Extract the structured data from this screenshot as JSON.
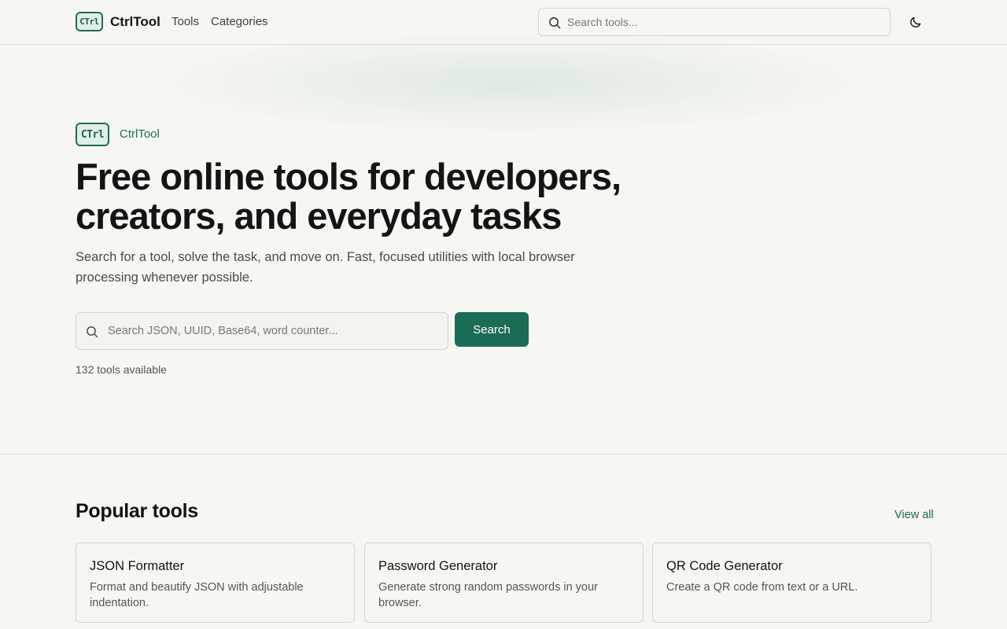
{
  "header": {
    "logo_text": "CTrl",
    "brand": "CtrlTool",
    "nav": [
      {
        "label": "Tools"
      },
      {
        "label": "Categories"
      }
    ],
    "search_placeholder": "Search tools...",
    "theme_icon": "moon-icon"
  },
  "hero": {
    "logo_text": "CTrl",
    "brand": "CtrlTool",
    "title": "Free online tools for developers, creators, and everyday tasks",
    "subtitle": "Search for a tool, solve the task, and move on. Fast, focused utilities with local browser processing whenever possible.",
    "search_placeholder": "Search JSON, UUID, Base64, word counter...",
    "search_button": "Search",
    "tool_count": "132 tools available"
  },
  "popular": {
    "title": "Popular tools",
    "view_all": "View all",
    "cards": [
      {
        "title": "JSON Formatter",
        "desc": "Format and beautify JSON with adjustable indentation."
      },
      {
        "title": "Password Generator",
        "desc": "Generate strong random passwords in your browser."
      },
      {
        "title": "QR Code Generator",
        "desc": "Create a QR code from text or a URL."
      }
    ]
  },
  "colors": {
    "accent": "#1a6c56",
    "background": "#f6f6f3"
  }
}
